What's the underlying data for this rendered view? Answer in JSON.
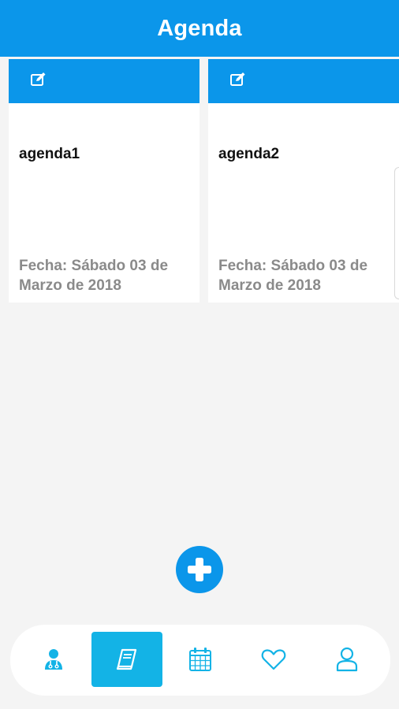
{
  "header": {
    "title": "Agenda"
  },
  "cards": [
    {
      "title": "agenda1",
      "date": "Fecha: Sábado 03 de Marzo de 2018"
    },
    {
      "title": "agenda2",
      "date": "Fecha: Sábado 03 de Marzo de 2018"
    }
  ],
  "colors": {
    "primary": "#0b96ea",
    "active_tab": "#13b3e6",
    "icon": "#13b3e6",
    "background": "#f4f4f4",
    "date_text": "#8a8a8a"
  },
  "fab": {
    "icon": "plus-icon"
  },
  "nav": {
    "items": [
      {
        "icon": "doctor-icon",
        "active": false
      },
      {
        "icon": "notebook-icon",
        "active": true
      },
      {
        "icon": "calendar-icon",
        "active": false
      },
      {
        "icon": "heart-icon",
        "active": false
      },
      {
        "icon": "user-icon",
        "active": false
      }
    ]
  }
}
